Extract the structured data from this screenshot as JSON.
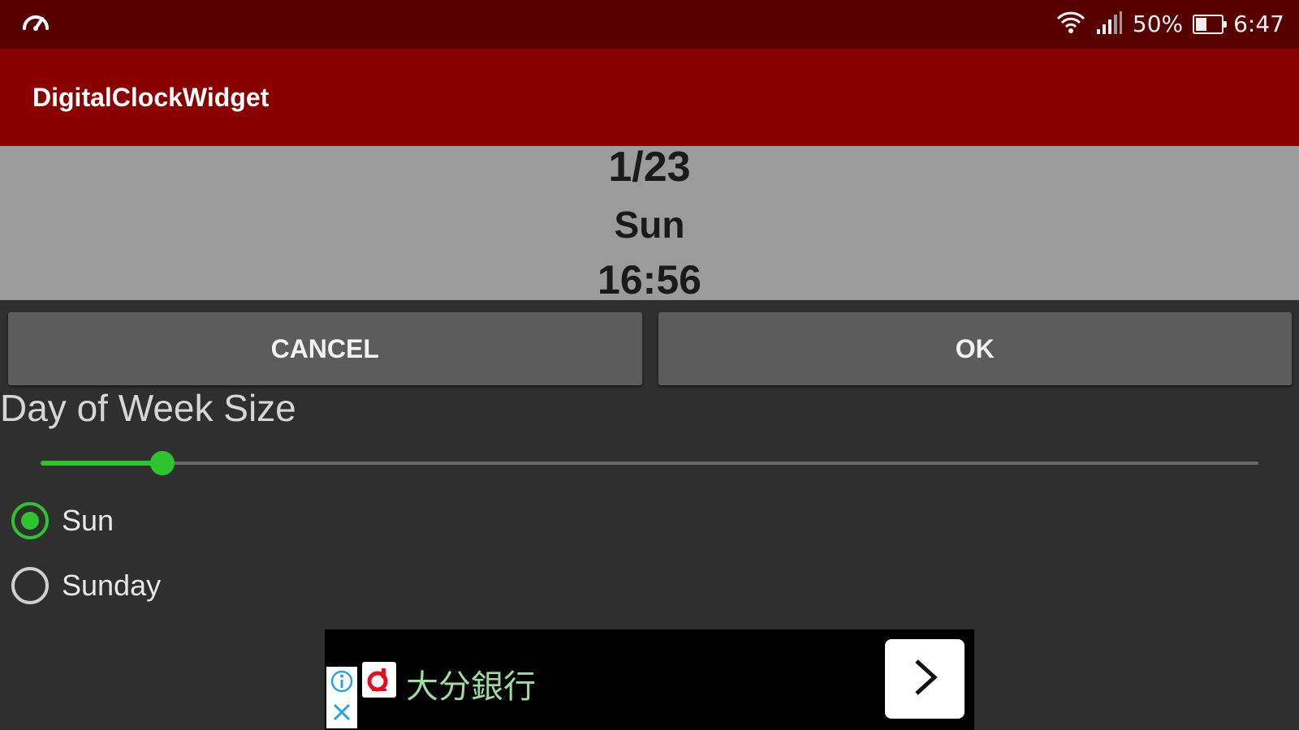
{
  "status_bar": {
    "battery_percent": "50%",
    "battery_level": 0.5,
    "time": "6:47",
    "icons": [
      "speedometer-icon",
      "wifi-icon",
      "cell-signal-icon",
      "battery-icon"
    ]
  },
  "app_bar": {
    "title": "DigitalClockWidget"
  },
  "preview": {
    "date": "1/23",
    "day_of_week": "Sun",
    "time": "16:56"
  },
  "buttons": {
    "cancel": "CANCEL",
    "ok": "OK"
  },
  "setting": {
    "title": "Day of Week Size",
    "slider_value": 0.1
  },
  "options": [
    {
      "label": "Sun",
      "checked": true
    },
    {
      "label": "Sunday",
      "checked": false
    }
  ],
  "ad": {
    "text": "大分銀行",
    "icons": [
      "adchoices-info-icon",
      "ad-close-icon",
      "bank-logo-icon",
      "chevron-right-icon"
    ]
  },
  "colors": {
    "status_bar": "#570000",
    "app_bar": "#8a0000",
    "accent": "#2ec42e",
    "preview_bg": "#9b9b9b",
    "background": "#2f2f2f"
  }
}
